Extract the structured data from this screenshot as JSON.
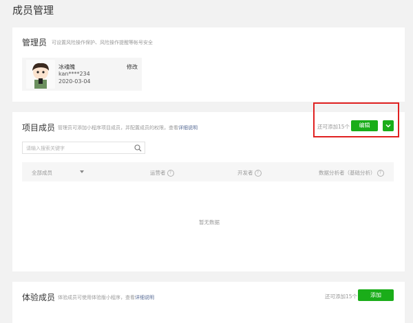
{
  "page": {
    "title": "成员管理"
  },
  "admin": {
    "title": "管理员",
    "desc": "可设置风险操作保护、风险操作提醒等帐号安全",
    "name": "冰魂魄",
    "account": "kan****234",
    "date": "2020-03-04",
    "edit": "修改"
  },
  "project": {
    "title": "项目成员",
    "desc": "管理员可添加小程序项目成员，并配置成员的权限，查看",
    "desc_link": "详细说明",
    "remaining": "还可添加15个",
    "edit_button": "编辑",
    "search_placeholder": "请输入搜索关键字",
    "columns": [
      "全部成员",
      "运营者",
      "开发者",
      "数据分析者（基础分析）"
    ],
    "empty": "暂无数据"
  },
  "trial": {
    "title": "体验成员",
    "desc": "体验成员可使用体验版小程序，查看",
    "desc_link": "详细说明",
    "remaining": "还可添加15个",
    "add_button": "添加"
  },
  "colors": {
    "primary": "#1aad19",
    "link": "#576b95",
    "highlight": "#e02020"
  }
}
